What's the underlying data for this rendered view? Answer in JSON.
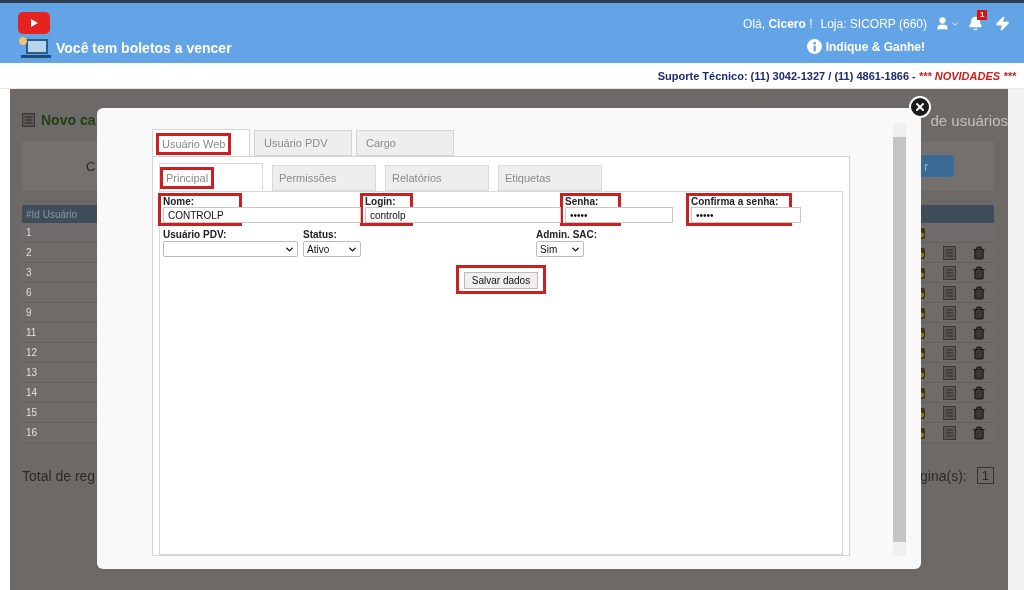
{
  "header": {
    "notice": "Você tem boletos a vencer",
    "greeting": "Olá,",
    "user_name": "Cicero",
    "greeting_end": "!",
    "store": "Loja: SICORP (660)",
    "notification_count": "1",
    "referral": "Indique & Ganhe!"
  },
  "support": {
    "text": "Suporte Técnico: (11) 3042-1327 / (11) 4861-1866 -",
    "news": "*** NOVIDADES ***"
  },
  "background": {
    "title": "Novo ca",
    "subtitle": "de usuários",
    "filter_label": "C",
    "button": "r",
    "column": "#Id Usuário",
    "total": "Total de reg",
    "pages_label": "gina(s):",
    "page": "1",
    "rows": [
      {
        "number": "1",
        "removable": false
      },
      {
        "number": "2",
        "removable": true
      },
      {
        "number": "3",
        "removable": true
      },
      {
        "number": "6",
        "removable": true
      },
      {
        "number": "9",
        "removable": true
      },
      {
        "number": "11",
        "removable": true
      },
      {
        "number": "12",
        "removable": true
      },
      {
        "number": "13",
        "removable": true
      },
      {
        "number": "14",
        "removable": true
      },
      {
        "number": "15",
        "removable": true
      },
      {
        "number": "16",
        "removable": true
      }
    ]
  },
  "modal": {
    "tabs": [
      {
        "label": "Usuário Web",
        "selected": true,
        "highlighted": true
      },
      {
        "label": "Usuário PDV",
        "selected": false,
        "highlighted": false
      },
      {
        "label": "Cargo",
        "selected": false,
        "highlighted": false
      }
    ],
    "subtabs": [
      {
        "label": "Principal",
        "selected": true,
        "highlighted": true
      },
      {
        "label": "Permissões",
        "selected": false,
        "highlighted": false
      },
      {
        "label": "Relatórios",
        "selected": false,
        "highlighted": false
      },
      {
        "label": "Etiquetas",
        "selected": false,
        "highlighted": false
      }
    ],
    "fields": [
      {
        "label": "Nome:",
        "value": "CONTROLP",
        "highlighted": true
      },
      {
        "label": "Login:",
        "value": "controlp",
        "highlighted": true
      },
      {
        "label": "Senha:",
        "value": "•••••",
        "highlighted": true
      },
      {
        "label": "Confirma a senha:",
        "value": "•••••",
        "highlighted": true
      }
    ],
    "selects": [
      {
        "label": "Usuário PDV:"
      },
      {
        "label": "Status:",
        "value": "Ativo"
      },
      {
        "label": "Admin. SAC:",
        "value": "Sim"
      }
    ],
    "save_button": {
      "label": "Salvar dados",
      "highlighted": true
    }
  }
}
